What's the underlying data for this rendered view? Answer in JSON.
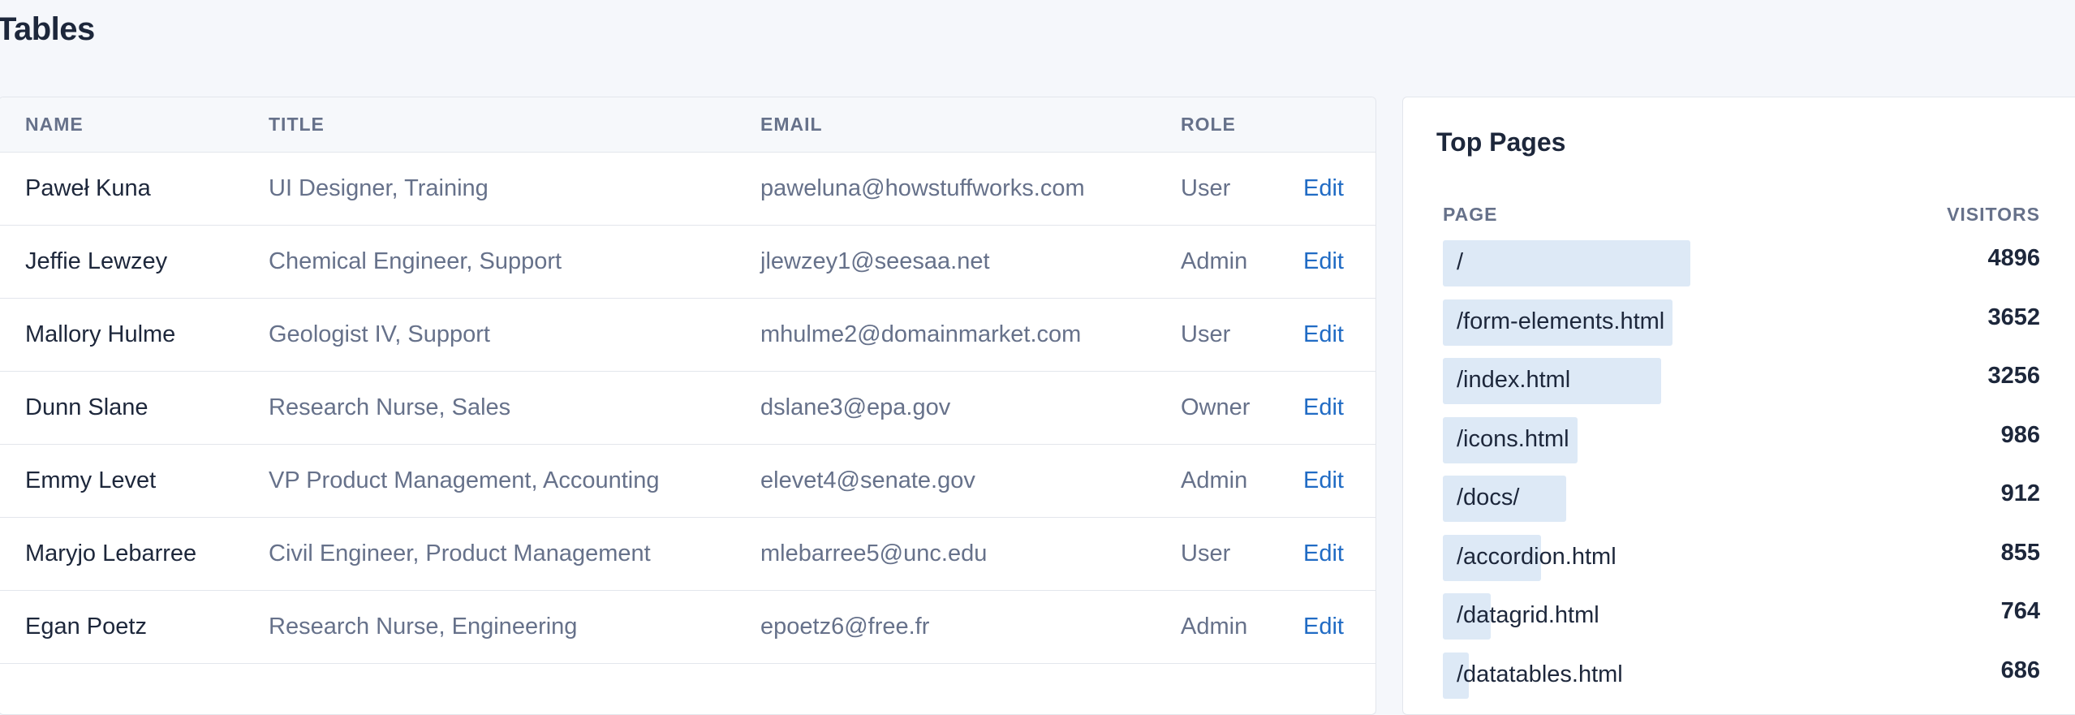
{
  "page": {
    "title": "Tables"
  },
  "users_table": {
    "headers": {
      "name": "NAME",
      "title": "TITLE",
      "email": "EMAIL",
      "role": "ROLE"
    },
    "edit_label": "Edit",
    "rows": [
      {
        "name": "Paweł Kuna",
        "title": "UI Designer, Training",
        "email": "paweluna@howstuffworks.com",
        "role": "User"
      },
      {
        "name": "Jeffie Lewzey",
        "title": "Chemical Engineer, Support",
        "email": "jlewzey1@seesaa.net",
        "role": "Admin"
      },
      {
        "name": "Mallory Hulme",
        "title": "Geologist IV, Support",
        "email": "mhulme2@domainmarket.com",
        "role": "User"
      },
      {
        "name": "Dunn Slane",
        "title": "Research Nurse, Sales",
        "email": "dslane3@epa.gov",
        "role": "Owner"
      },
      {
        "name": "Emmy Levet",
        "title": "VP Product Management, Accounting",
        "email": "elevet4@senate.gov",
        "role": "Admin"
      },
      {
        "name": "Maryjo Lebarree",
        "title": "Civil Engineer, Product Management",
        "email": "mlebarree5@unc.edu",
        "role": "User"
      },
      {
        "name": "Egan Poetz",
        "title": "Research Nurse, Engineering",
        "email": "epoetz6@free.fr",
        "role": "Admin"
      }
    ]
  },
  "top_pages": {
    "title": "Top Pages",
    "headers": {
      "page": "PAGE",
      "visitors": "VISITORS"
    },
    "bar_color": "#dde9f6",
    "rows": [
      {
        "path": "/",
        "visitors": "4896",
        "fill": 0.415
      },
      {
        "path": "/form-elements.html",
        "visitors": "3652",
        "fill": 0.384
      },
      {
        "path": "/index.html",
        "visitors": "3256",
        "fill": 0.366
      },
      {
        "path": "/icons.html",
        "visitors": "986",
        "fill": 0.226
      },
      {
        "path": "/docs/",
        "visitors": "912",
        "fill": 0.207
      },
      {
        "path": "/accordion.html",
        "visitors": "855",
        "fill": 0.165
      },
      {
        "path": "/datagrid.html",
        "visitors": "764",
        "fill": 0.08
      },
      {
        "path": "/datatables.html",
        "visitors": "686",
        "fill": 0.044
      }
    ]
  }
}
